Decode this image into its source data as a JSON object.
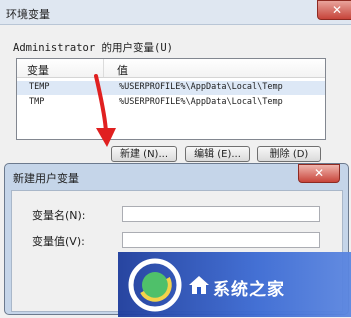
{
  "outer_dialog": {
    "title": "环境变量",
    "close_label": "✕",
    "user_vars_group_label": "Administrator 的用户变量(U)",
    "list_headers": {
      "variable": "变量",
      "value": "值"
    },
    "rows": [
      {
        "variable": "TEMP",
        "value": "%USERPROFILE%\\AppData\\Local\\Temp"
      },
      {
        "variable": "TMP",
        "value": "%USERPROFILE%\\AppData\\Local\\Temp"
      }
    ],
    "buttons": {
      "new": "新建 (N)...",
      "edit": "编辑 (E)...",
      "delete": "删除 (D)"
    }
  },
  "inner_dialog": {
    "title": "新建用户变量",
    "close_label": "✕",
    "name_label": "变量名(N):",
    "value_label": "变量值(V):",
    "name_value": "",
    "value_value": ""
  },
  "watermark": {
    "text": "系统之家"
  },
  "colors": {
    "arrow": "#e02020",
    "selection": "#dde8f6",
    "close": "#c6443a"
  }
}
